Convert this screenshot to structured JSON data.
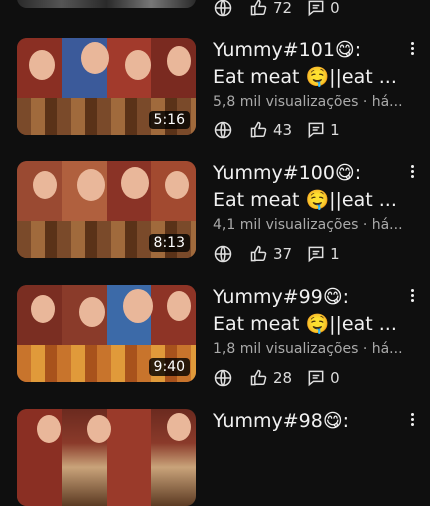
{
  "top_item": {
    "likes": "72",
    "comments": "0"
  },
  "videos": [
    {
      "title_line1": "Yummy#101😋:",
      "title_line2": "Eat meat 🤤||eat ...",
      "meta": "5,8 mil visualizações · há...",
      "duration": "5:16",
      "likes": "43",
      "comments": "1"
    },
    {
      "title_line1": "Yummy#100😋:",
      "title_line2": "Eat meat 🤤||eat ...",
      "meta": "4,1 mil visualizações · há...",
      "duration": "8:13",
      "likes": "37",
      "comments": "1"
    },
    {
      "title_line1": "Yummy#99😋:",
      "title_line2": "Eat meat 🤤||eat ...",
      "meta": "1,8 mil visualizações · há...",
      "duration": "9:40",
      "likes": "28",
      "comments": "0"
    },
    {
      "title_line1": "Yummy#98😋:"
    }
  ],
  "icons": {
    "globe": "globe-icon",
    "like": "thumbs-up-icon",
    "comment": "comment-icon",
    "more": "more-vert-icon"
  },
  "colors": {
    "background": "#0f0f0f",
    "text": "#f1f1f1",
    "secondary": "#aaaaaa"
  }
}
